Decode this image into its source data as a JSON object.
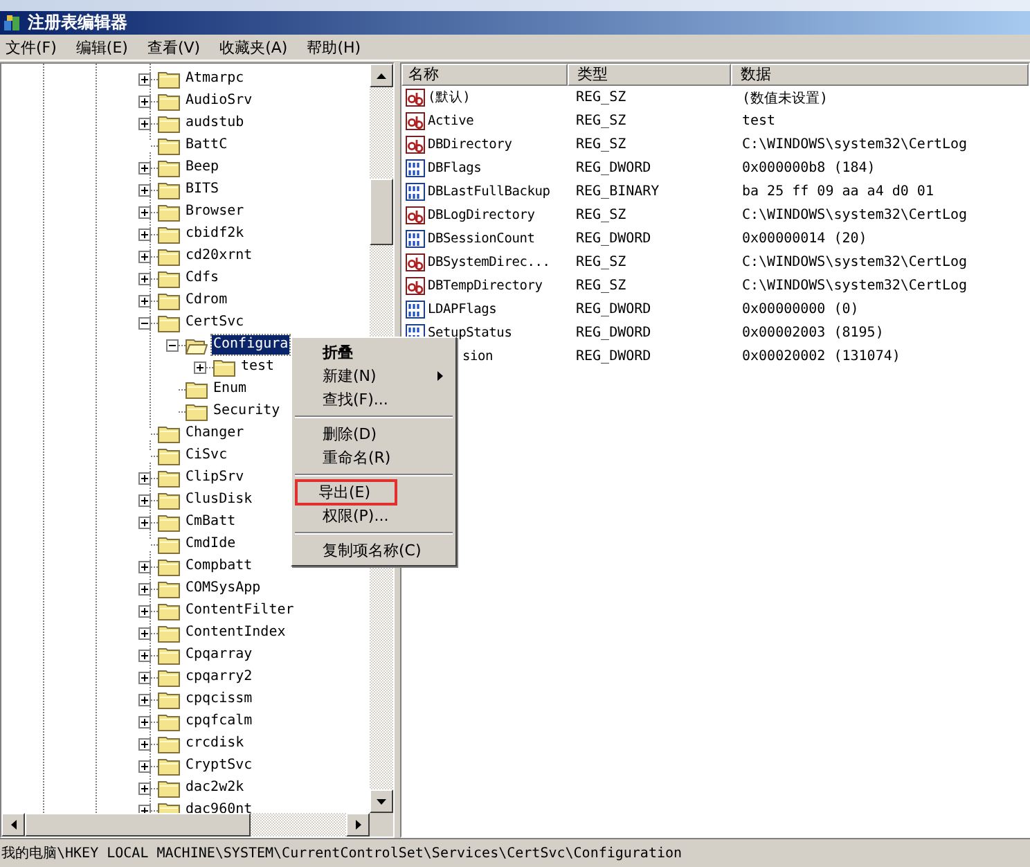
{
  "window": {
    "title": "注册表编辑器"
  },
  "menu_bar": [
    "文件(F)",
    "编辑(E)",
    "查看(V)",
    "收藏夹(A)",
    "帮助(H)"
  ],
  "tree": [
    {
      "label": "Atmarpc",
      "kind": "branch",
      "expanded": false,
      "selected": false
    },
    {
      "label": "AudioSrv",
      "kind": "branch",
      "expanded": false,
      "selected": false
    },
    {
      "label": "audstub",
      "kind": "branch",
      "expanded": false,
      "selected": false
    },
    {
      "label": "BattC",
      "kind": "leaf",
      "selected": false
    },
    {
      "label": "Beep",
      "kind": "branch",
      "expanded": false,
      "selected": false
    },
    {
      "label": "BITS",
      "kind": "branch",
      "expanded": false,
      "selected": false
    },
    {
      "label": "Browser",
      "kind": "branch",
      "expanded": false,
      "selected": false
    },
    {
      "label": "cbidf2k",
      "kind": "branch",
      "expanded": false,
      "selected": false
    },
    {
      "label": "cd20xrnt",
      "kind": "branch",
      "expanded": false,
      "selected": false
    },
    {
      "label": "Cdfs",
      "kind": "branch",
      "expanded": false,
      "selected": false
    },
    {
      "label": "Cdrom",
      "kind": "branch",
      "expanded": false,
      "selected": false
    },
    {
      "label": "CertSvc",
      "kind": "branch",
      "expanded": true,
      "selected": false,
      "children": [
        {
          "label": "Configura",
          "kind": "branch",
          "expanded": true,
          "selected": true,
          "children": [
            {
              "label": "test",
              "kind": "branch",
              "expanded": false,
              "selected": false
            }
          ]
        },
        {
          "label": "Enum",
          "kind": "leaf",
          "selected": false
        },
        {
          "label": "Security",
          "kind": "leaf",
          "selected": false
        }
      ]
    },
    {
      "label": "Changer",
      "kind": "leaf",
      "selected": false
    },
    {
      "label": "CiSvc",
      "kind": "leaf",
      "selected": false
    },
    {
      "label": "ClipSrv",
      "kind": "branch",
      "expanded": false,
      "selected": false
    },
    {
      "label": "ClusDisk",
      "kind": "branch",
      "expanded": false,
      "selected": false
    },
    {
      "label": "CmBatt",
      "kind": "branch",
      "expanded": false,
      "selected": false
    },
    {
      "label": "CmdIde",
      "kind": "leaf",
      "selected": false
    },
    {
      "label": "Compbatt",
      "kind": "branch",
      "expanded": false,
      "selected": false
    },
    {
      "label": "COMSysApp",
      "kind": "branch",
      "expanded": false,
      "selected": false
    },
    {
      "label": "ContentFilter",
      "kind": "branch",
      "expanded": false,
      "selected": false
    },
    {
      "label": "ContentIndex",
      "kind": "branch",
      "expanded": false,
      "selected": false
    },
    {
      "label": "Cpqarray",
      "kind": "branch",
      "expanded": false,
      "selected": false
    },
    {
      "label": "cpqarry2",
      "kind": "branch",
      "expanded": false,
      "selected": false
    },
    {
      "label": "cpqcissm",
      "kind": "branch",
      "expanded": false,
      "selected": false
    },
    {
      "label": "cpqfcalm",
      "kind": "branch",
      "expanded": false,
      "selected": false
    },
    {
      "label": "crcdisk",
      "kind": "branch",
      "expanded": false,
      "selected": false
    },
    {
      "label": "CryptSvc",
      "kind": "branch",
      "expanded": false,
      "selected": false
    },
    {
      "label": "dac2w2k",
      "kind": "branch",
      "expanded": false,
      "selected": false
    },
    {
      "label": "dac960nt",
      "kind": "branch",
      "expanded": false,
      "selected": false
    }
  ],
  "values": {
    "columns": [
      "名称",
      "类型",
      "数据"
    ],
    "rows": [
      {
        "kind": "string",
        "name": "(默认)",
        "type": "REG_SZ",
        "data": "(数值未设置)"
      },
      {
        "kind": "string",
        "name": "Active",
        "type": "REG_SZ",
        "data": "test"
      },
      {
        "kind": "string",
        "name": "DBDirectory",
        "type": "REG_SZ",
        "data": "C:\\WINDOWS\\system32\\CertLog"
      },
      {
        "kind": "binary",
        "name": "DBFlags",
        "type": "REG_DWORD",
        "data": "0x000000b8 (184)"
      },
      {
        "kind": "binary",
        "name": "DBLastFullBackup",
        "type": "REG_BINARY",
        "data": "ba 25 ff 09 aa a4 d0 01"
      },
      {
        "kind": "string",
        "name": "DBLogDirectory",
        "type": "REG_SZ",
        "data": "C:\\WINDOWS\\system32\\CertLog"
      },
      {
        "kind": "binary",
        "name": "DBSessionCount",
        "type": "REG_DWORD",
        "data": "0x00000014 (20)"
      },
      {
        "kind": "string",
        "name": "DBSystemDirec...",
        "type": "REG_SZ",
        "data": "C:\\WINDOWS\\system32\\CertLog"
      },
      {
        "kind": "string",
        "name": "DBTempDirectory",
        "type": "REG_SZ",
        "data": "C:\\WINDOWS\\system32\\CertLog"
      },
      {
        "kind": "binary",
        "name": "LDAPFlags",
        "type": "REG_DWORD",
        "data": "0x00000000 (0)"
      },
      {
        "kind": "binary",
        "name": "SetupStatus",
        "type": "REG_DWORD",
        "data": "0x00002003 (8195)"
      },
      {
        "kind": "covered",
        "name": "sion",
        "type": "REG_DWORD",
        "data": "0x00020002 (131074)"
      }
    ]
  },
  "context_menu": [
    {
      "kind": "item",
      "label": "折叠",
      "bold": true,
      "submenu": false,
      "annotated": false
    },
    {
      "kind": "item",
      "label": "新建(N)",
      "bold": false,
      "submenu": true,
      "annotated": false
    },
    {
      "kind": "item",
      "label": "查找(F)...",
      "bold": false,
      "submenu": false,
      "annotated": false
    },
    {
      "kind": "separator"
    },
    {
      "kind": "item",
      "label": "删除(D)",
      "bold": false,
      "submenu": false,
      "annotated": false
    },
    {
      "kind": "item",
      "label": "重命名(R)",
      "bold": false,
      "submenu": false,
      "annotated": false
    },
    {
      "kind": "separator"
    },
    {
      "kind": "item",
      "label": "导出(E)",
      "bold": false,
      "submenu": false,
      "annotated": true
    },
    {
      "kind": "item",
      "label": "权限(P)...",
      "bold": false,
      "submenu": false,
      "annotated": false
    },
    {
      "kind": "separator"
    },
    {
      "kind": "item",
      "label": "复制项名称(C)",
      "bold": false,
      "submenu": false,
      "annotated": false
    }
  ],
  "status_bar": "我的电脑\\HKEY LOCAL MACHINE\\SYSTEM\\CurrentControlSet\\Services\\CertSvc\\Configuration"
}
